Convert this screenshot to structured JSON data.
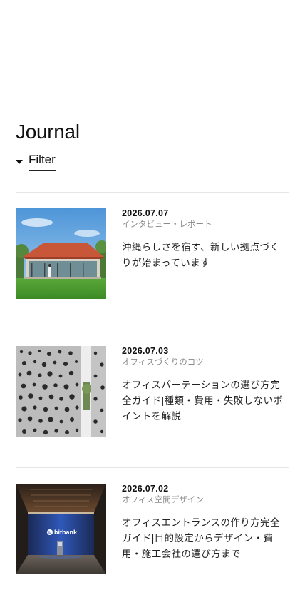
{
  "page": {
    "title": "Journal",
    "filter_label": "Filter"
  },
  "articles": [
    {
      "date": "2026.07.07",
      "category": "インタビュー・レポート",
      "headline": "沖縄らしさを宿す、新しい拠点づくりが始まっています",
      "thumbnail": "okinawa-house-photo"
    },
    {
      "date": "2026.07.03",
      "category": "オフィスづくりのコツ",
      "headline": "オフィスパーテーションの選び方完全ガイド|種類・費用・失敗しないポイントを解説",
      "thumbnail": "perforated-partition-photo"
    },
    {
      "date": "2026.07.02",
      "category": "オフィス空間デザイン",
      "headline": "オフィスエントランスの作り方完全ガイド|目的設定からデザイン・費用・施工会社の選び方まで",
      "thumbnail": "office-entrance-photo",
      "sign_text": "bitbank"
    }
  ],
  "colors": {
    "divider": "#e6e6e6",
    "category_text": "#8a8a8a",
    "body_text": "#222222"
  }
}
